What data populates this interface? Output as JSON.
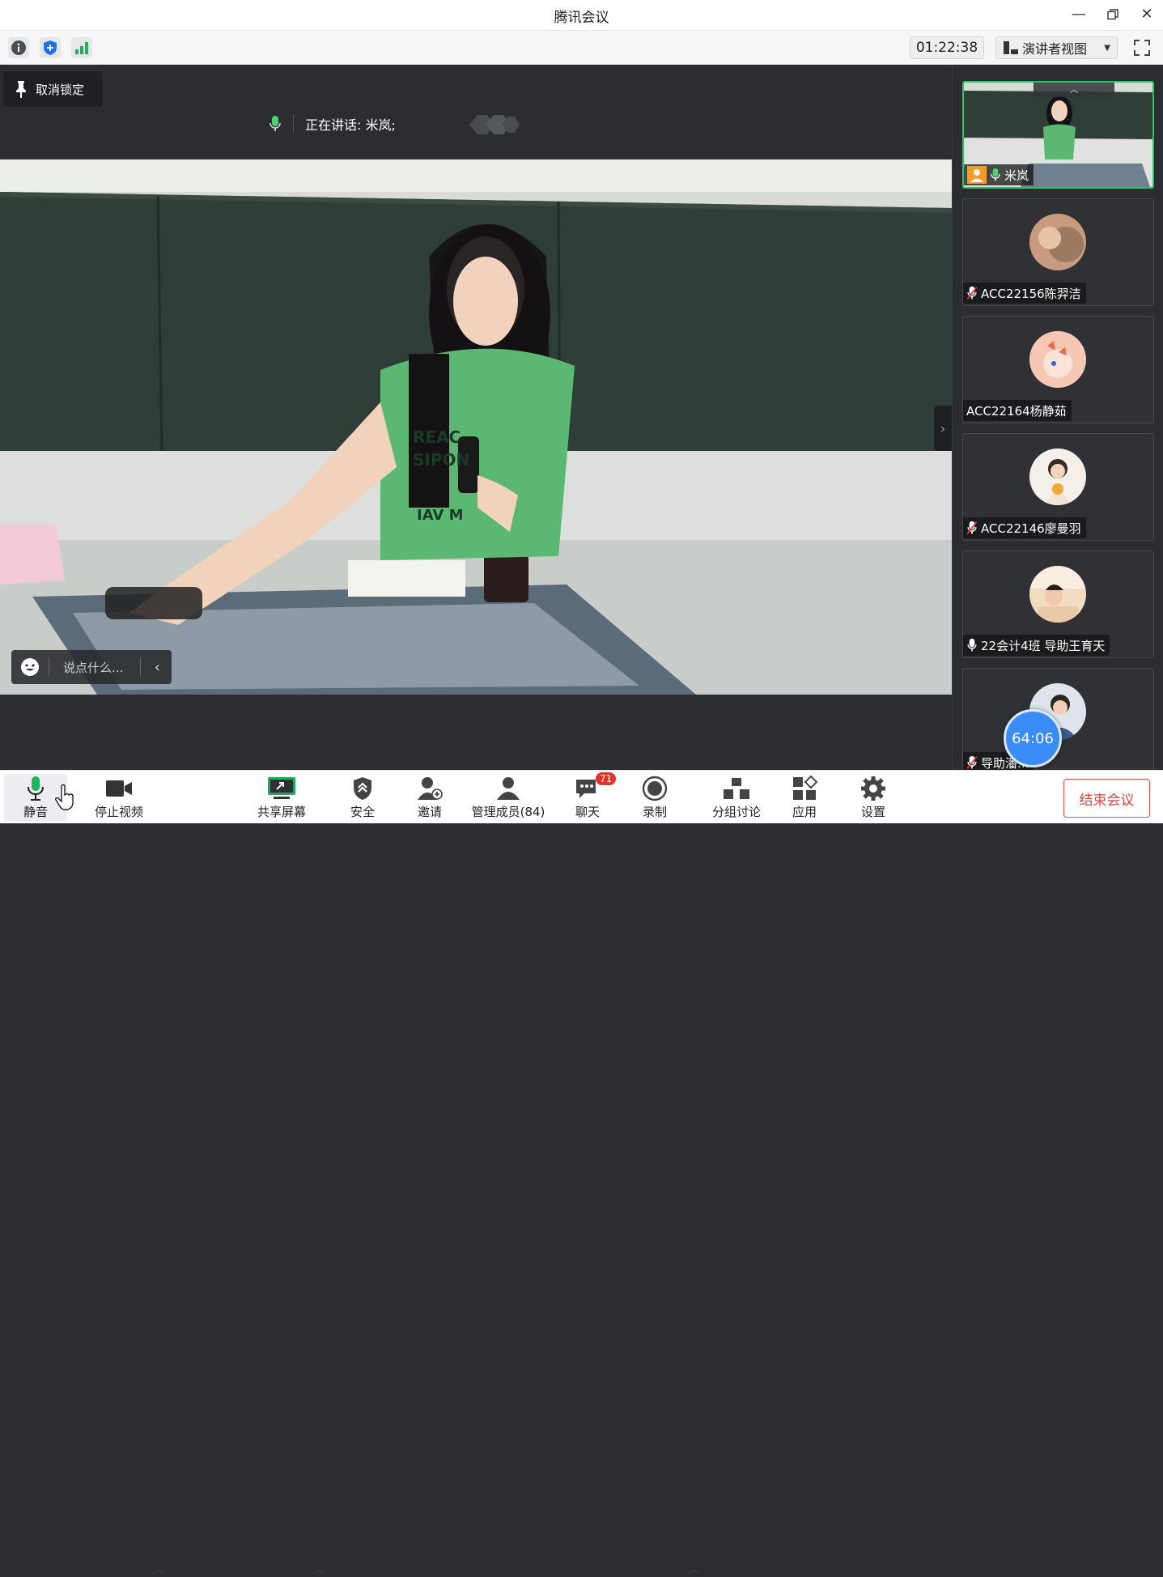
{
  "window": {
    "title": "腾讯会议"
  },
  "infobar": {
    "timer": "01:22:38",
    "view_mode": "演讲者视图"
  },
  "stage": {
    "unlock_label": "取消锁定",
    "speaking_text": "正在讲话: 米岚;",
    "chat_placeholder": "说点什么..."
  },
  "participants": [
    {
      "name": "米岚",
      "mic": "on",
      "active": true,
      "host_icon": true
    },
    {
      "name": "ACC22156陈羿洁",
      "mic": "muted"
    },
    {
      "name": "ACC22164杨静茹",
      "mic": "none"
    },
    {
      "name": "ACC22146廖曼羽",
      "mic": "muted"
    },
    {
      "name": "22会计4班 导助王育天",
      "mic": "on"
    },
    {
      "name": "导助潘...",
      "mic": "muted"
    }
  ],
  "floating_timer": "64:06",
  "toolbar": {
    "mute": "静音",
    "stop_video": "停止视频",
    "share_screen": "共享屏幕",
    "security": "安全",
    "invite": "邀请",
    "manage_members": "管理成员(84)",
    "chat": "聊天",
    "chat_badge": "71",
    "record": "录制",
    "breakout": "分组讨论",
    "apps": "应用",
    "settings": "设置",
    "end_meeting": "结束会议"
  },
  "colors": {
    "accent_green": "#2ec26a",
    "end_red": "#e0463b",
    "badge_red": "#e0342f",
    "timer_blue": "#3b8cf7",
    "stage_bg": "#2b2d31"
  }
}
